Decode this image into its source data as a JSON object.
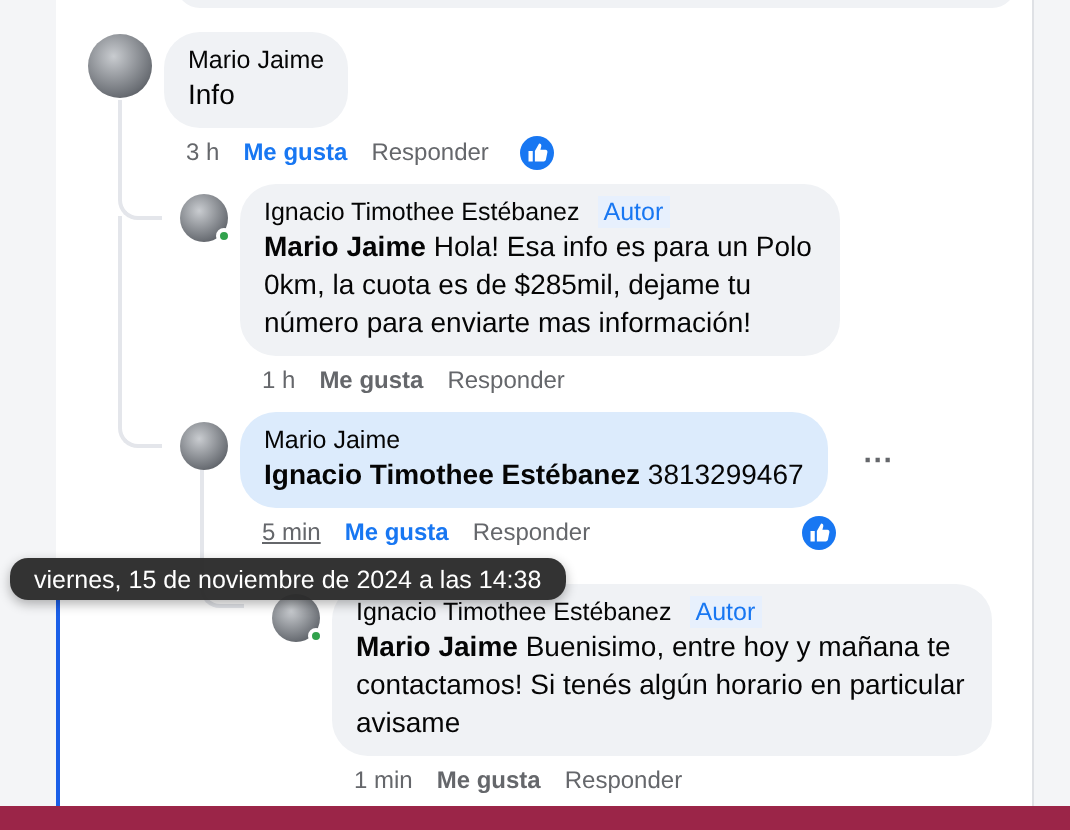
{
  "comments": [
    {
      "author": "Mario Jaime",
      "text": "Info",
      "time": "3 h",
      "like_label": "Me gusta",
      "reply_label": "Responder",
      "liked": true,
      "reaction": true,
      "highlighted": false,
      "online": false,
      "time_hovered": false,
      "children": [
        {
          "author": "Ignacio Timothee Estébanez",
          "badge": "Autor",
          "mention": "Mario Jaime",
          "text": "Hola! Esa info es para un Polo 0km, la cuota es de $285mil, dejame tu número para enviarte mas información!",
          "time": "1 h",
          "like_label": "Me gusta",
          "reply_label": "Responder",
          "liked": false,
          "reaction": false,
          "highlighted": false,
          "online": true,
          "time_hovered": false
        },
        {
          "author": "Mario Jaime",
          "mention": "Ignacio Timothee Estébanez",
          "text": "3813299467",
          "time": "5 min",
          "like_label": "Me gusta",
          "reply_label": "Responder",
          "liked": true,
          "reaction": true,
          "highlighted": true,
          "online": false,
          "time_hovered": true,
          "menu": "···",
          "children": [
            {
              "author": "Ignacio Timothee Estébanez",
              "badge": "Autor",
              "mention": "Mario Jaime",
              "text": "Buenisimo, entre hoy y mañana te contactamos! Si tenés algún horario en particular avisame",
              "time": "1 min",
              "like_label": "Me gusta",
              "reply_label": "Responder",
              "liked": false,
              "reaction": false,
              "highlighted": false,
              "online": true,
              "time_hovered": false
            }
          ]
        }
      ]
    }
  ],
  "tooltip": "viernes, 15 de noviembre de 2024 a las 14:38"
}
